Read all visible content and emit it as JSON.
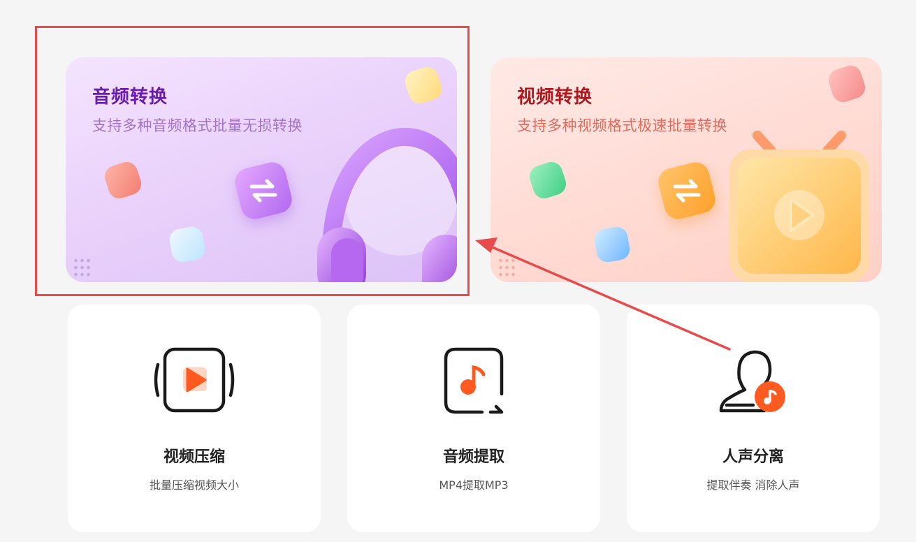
{
  "cards": {
    "audio_convert": {
      "title": "音频转换",
      "subtitle": "支持多种音频格式批量无损转换",
      "title_color": "#6a1bb0",
      "accent": "#b169ef"
    },
    "video_convert": {
      "title": "视频转换",
      "subtitle": "支持多种视频格式极速批量转换",
      "title_color": "#b3161c",
      "accent": "#ff9f2a"
    }
  },
  "tools": [
    {
      "title": "视频压缩",
      "subtitle": "批量压缩视频大小",
      "icon": "video-compress-icon"
    },
    {
      "title": "音频提取",
      "subtitle": "MP4提取MP3",
      "icon": "audio-extract-icon"
    },
    {
      "title": "人声分离",
      "subtitle": "提取伴奏 消除人声",
      "icon": "vocal-separation-icon"
    }
  ],
  "annotation": {
    "highlight_color": "#e84b4b"
  },
  "colors": {
    "background": "#f5f5f5",
    "icon_accent": "#ff5a1f"
  }
}
